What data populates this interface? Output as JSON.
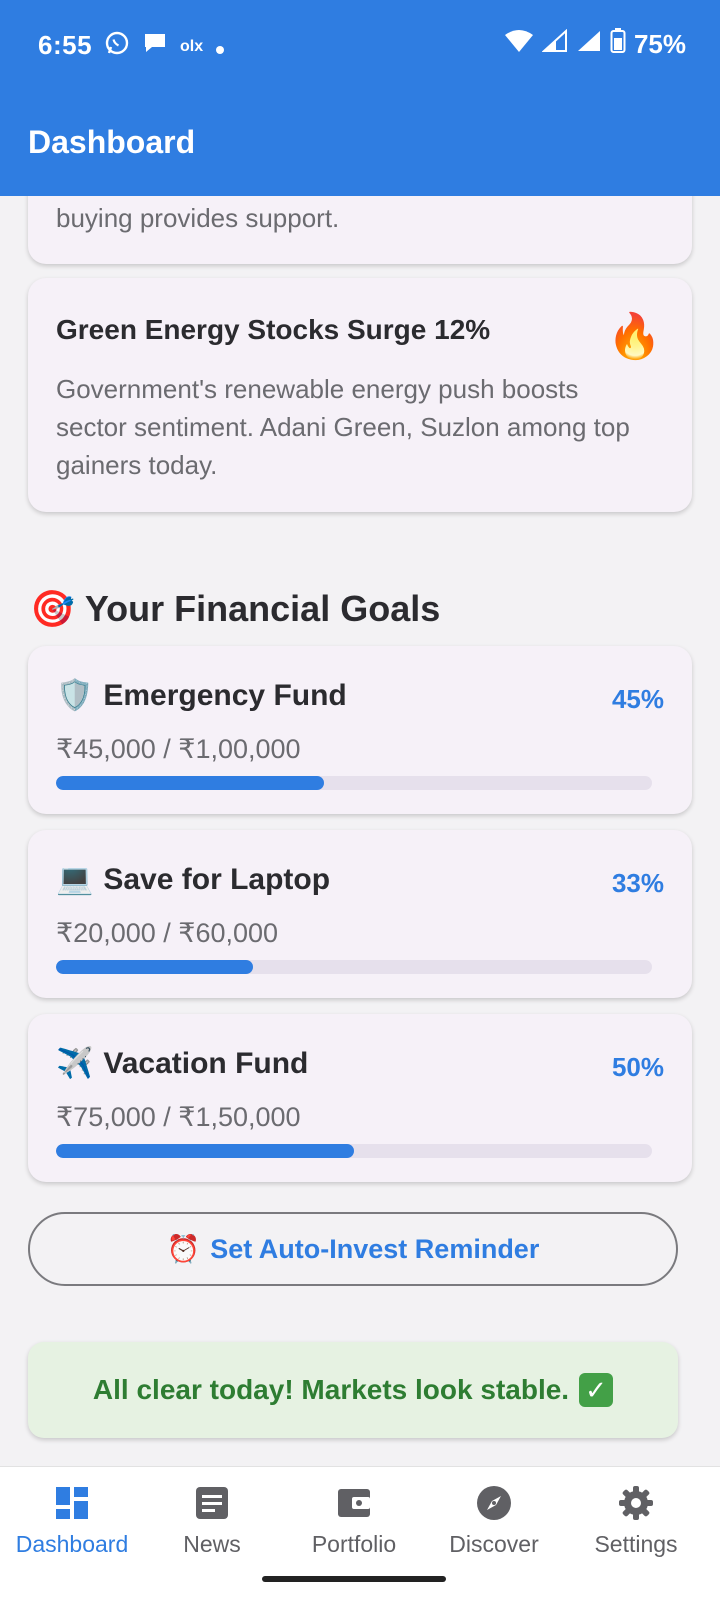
{
  "status_bar": {
    "time": "6:55",
    "battery": "75%",
    "notification_icons": [
      "whatsapp-icon",
      "chat-bubble-icon",
      "olx-icon",
      "dot-icon"
    ]
  },
  "app_bar": {
    "title": "Dashboard"
  },
  "partial_card": {
    "text": "buying provides support."
  },
  "news_card": {
    "title": "Green Energy Stocks Surge 12%",
    "emoji": "🔥",
    "body": "Government's renewable energy push boosts sector sentiment. Adani Green, Suzlon among top gainers today."
  },
  "goals_section": {
    "icon": "🎯",
    "title": "Your Financial Goals"
  },
  "goals": [
    {
      "icon": "🛡️",
      "name": "Emergency Fund",
      "percent_label": "45%",
      "progress": 0.45,
      "amount": "₹45,000 / ₹1,00,000"
    },
    {
      "icon": "💻",
      "name": "Save for Laptop",
      "percent_label": "33%",
      "progress": 0.33,
      "amount": "₹20,000 / ₹60,000"
    },
    {
      "icon": "✈️",
      "name": "Vacation Fund",
      "percent_label": "50%",
      "progress": 0.5,
      "amount": "₹75,000 / ₹1,50,000"
    }
  ],
  "reminder_button": {
    "icon": "⏰",
    "label": "Set Auto-Invest Reminder"
  },
  "alert": {
    "text": "All clear today! Markets look stable.",
    "icon": "✓"
  },
  "bottom_nav": [
    {
      "label": "Dashboard",
      "icon": "dashboard-icon",
      "active": true
    },
    {
      "label": "News",
      "icon": "news-icon",
      "active": false
    },
    {
      "label": "Portfolio",
      "icon": "wallet-icon",
      "active": false
    },
    {
      "label": "Discover",
      "icon": "compass-icon",
      "active": false
    },
    {
      "label": "Settings",
      "icon": "gear-icon",
      "active": false
    }
  ],
  "colors": {
    "primary": "#2f7de1",
    "success": "#2e7d32",
    "card_bg": "#f6f1f8"
  }
}
